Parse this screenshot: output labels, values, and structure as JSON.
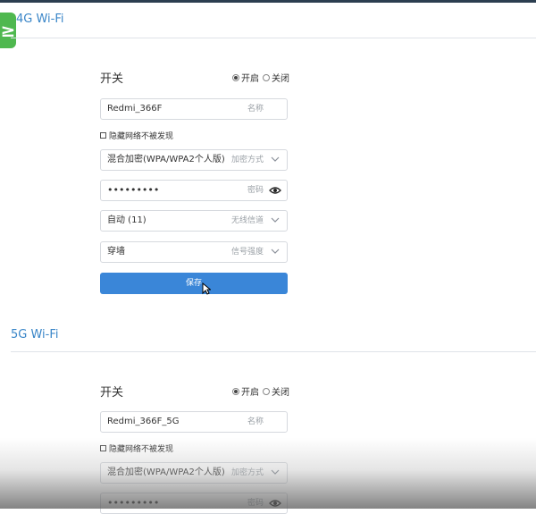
{
  "wifi24": {
    "title": "4G Wi-Fi",
    "switch_label": "开关",
    "radio_on": "开启",
    "radio_off": "关闭",
    "ssid_value": "Redmi_366F",
    "ssid_placeholder": "名称",
    "hide_network": "隐藏网络不被发现",
    "encryption_value": "混合加密(WPA/WPA2个人版)",
    "encryption_placeholder": "加密方式",
    "password_value": "•••••••••",
    "password_placeholder": "密码",
    "channel_value": "自动 (11)",
    "channel_placeholder": "无线信道",
    "signal_value": "穿墙",
    "signal_placeholder": "信号强度",
    "save_label": "保存"
  },
  "wifi5": {
    "title": "5G Wi-Fi",
    "switch_label": "开关",
    "radio_on": "开启",
    "radio_off": "关闭",
    "ssid_value": "Redmi_366F_5G",
    "ssid_placeholder": "名称",
    "hide_network": "隐藏网络不被发现",
    "encryption_value": "混合加密(WPA/WPA2个人版)",
    "encryption_placeholder": "加密方式",
    "password_value": "•••••••••",
    "password_placeholder": "密码"
  },
  "icons": {
    "badge": "app-badge-icon",
    "chevron": "chevron-down-icon",
    "eye": "eye-icon",
    "cursor": "mouse-cursor-icon"
  },
  "colors": {
    "accent": "#3a86c8",
    "button": "#3a86d8",
    "badge": "#4fb84f"
  }
}
